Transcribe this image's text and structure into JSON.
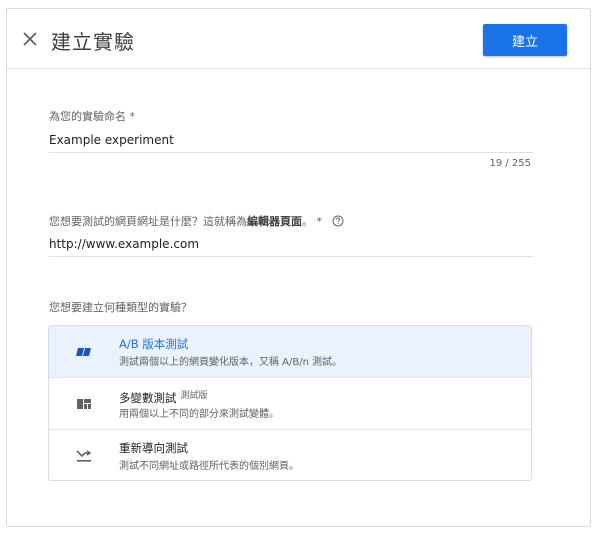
{
  "header": {
    "title": "建立實驗",
    "create_label": "建立"
  },
  "name_field": {
    "label": "為您的實驗命名 *",
    "value": "Example experiment",
    "counter": "19 / 255"
  },
  "url_field": {
    "label_prefix": "您想要測試的網頁網址是什麼？這就稱為",
    "label_bold": "編輯器頁面",
    "label_suffix": "。 *",
    "value": "http://www.example.com"
  },
  "type_question": "您想要建立何種類型的實驗？",
  "experiment_types": [
    {
      "title": "A/B 版本測試",
      "desc": "測試兩個以上的網頁變化版本，又稱 A/B/n 測試。",
      "icon": "ab-test-icon",
      "selected": true
    },
    {
      "title": "多變數測試",
      "beta": "測試版",
      "desc": "用兩個以上不同的部分來測試變體。",
      "icon": "multivariate-grid-icon",
      "selected": false
    },
    {
      "title": "重新導向測試",
      "desc": "測試不同網址或路徑所代表的個別網頁。",
      "icon": "redirect-arrow-icon",
      "selected": false
    }
  ],
  "colors": {
    "accent": "#1a73e8",
    "selected_bg": "#eaf2fd"
  }
}
